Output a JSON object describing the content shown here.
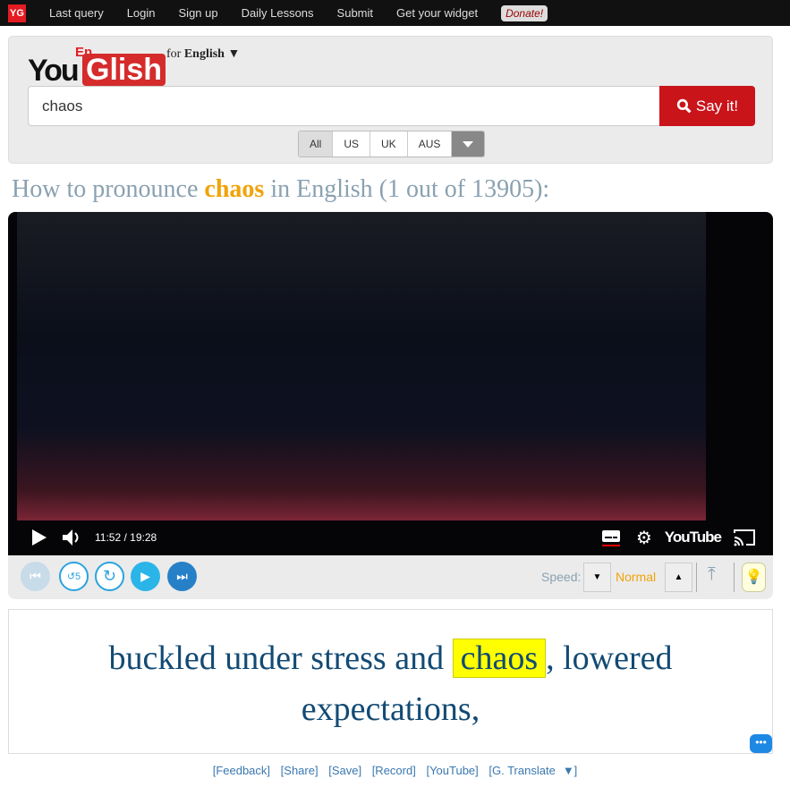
{
  "topbar": {
    "logo": "YG",
    "nav": [
      "Last query",
      "Login",
      "Sign up",
      "Daily Lessons",
      "Submit",
      "Get your widget"
    ],
    "donate": "Donate!"
  },
  "logo": {
    "you": "You",
    "en": "En",
    "glish": "Glish"
  },
  "language": {
    "prefix": "for",
    "name": "English",
    "arrow": "▼"
  },
  "search": {
    "value": "chaos",
    "button": "Say it!"
  },
  "accents": [
    "All",
    "US",
    "UK",
    "AUS"
  ],
  "heading": {
    "pre": "How to pronounce",
    "word": "chaos",
    "post": "in English (1 out of 13905):"
  },
  "player": {
    "time": "11:52 / 19:28",
    "brand": "YouTube"
  },
  "controls": {
    "speed_label": "Speed:",
    "speed_value": "Normal"
  },
  "caption": {
    "pre": "buckled under stress and",
    "word": "chaos",
    "post": ", lowered expectations,"
  },
  "links": [
    "[Feedback]",
    "[Share]",
    "[Save]",
    "[Record]",
    "[YouTube]",
    "[G. Translate",
    "▼]"
  ],
  "colors": {
    "accent": "#c9141a",
    "highlight": "#ffff00",
    "orange": "#f0a30a"
  }
}
